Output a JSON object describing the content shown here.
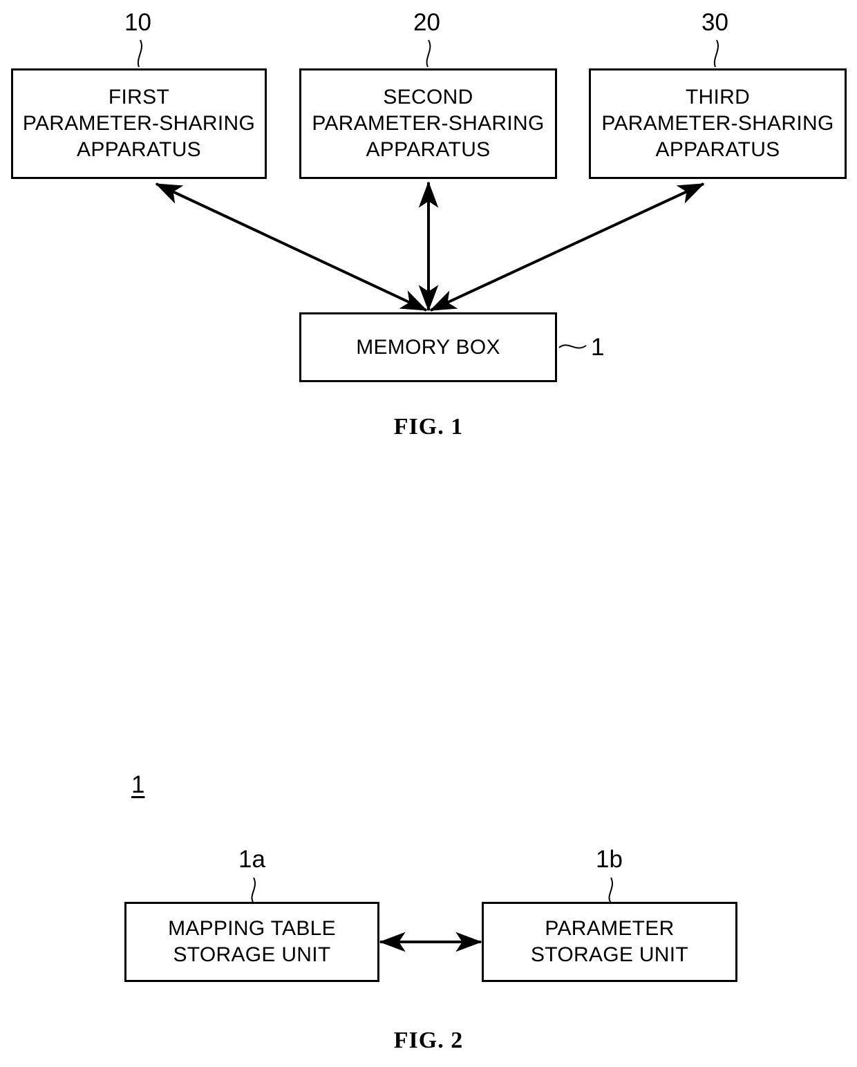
{
  "document": {
    "type": "patent-drawing-sheet",
    "figures": [
      {
        "id": "fig1",
        "caption": "FIG. 1",
        "nodes": [
          {
            "id": "first-apparatus",
            "label": "FIRST\nPARAMETER-SHARING\nAPPARATUS",
            "ref": "10"
          },
          {
            "id": "second-apparatus",
            "label": "SECOND\nPARAMETER-SHARING\nAPPARATUS",
            "ref": "20"
          },
          {
            "id": "third-apparatus",
            "label": "THIRD\nPARAMETER-SHARING\nAPPARATUS",
            "ref": "30"
          },
          {
            "id": "memory-box",
            "label": "MEMORY BOX",
            "ref": "1"
          }
        ],
        "connections": [
          {
            "from": "memory-box",
            "to": "first-apparatus",
            "style": "double-arrow"
          },
          {
            "from": "memory-box",
            "to": "second-apparatus",
            "style": "double-arrow"
          },
          {
            "from": "memory-box",
            "to": "third-apparatus",
            "style": "double-arrow"
          }
        ]
      },
      {
        "id": "fig2",
        "caption": "FIG. 2",
        "assembly_ref": "1",
        "nodes": [
          {
            "id": "mapping-table-storage-unit",
            "label": "MAPPING TABLE\nSTORAGE UNIT",
            "ref": "1a"
          },
          {
            "id": "parameter-storage-unit",
            "label": "PARAMETER\nSTORAGE UNIT",
            "ref": "1b"
          }
        ],
        "connections": [
          {
            "from": "mapping-table-storage-unit",
            "to": "parameter-storage-unit",
            "style": "double-arrow"
          }
        ]
      }
    ]
  },
  "fig1": {
    "caption": "FIG. 1",
    "box1": {
      "label": "FIRST\nPARAMETER-SHARING\nAPPARATUS",
      "ref": "10"
    },
    "box2": {
      "label": "SECOND\nPARAMETER-SHARING\nAPPARATUS",
      "ref": "20"
    },
    "box3": {
      "label": "THIRD\nPARAMETER-SHARING\nAPPARATUS",
      "ref": "30"
    },
    "memory": {
      "label": "MEMORY BOX",
      "ref": "1"
    }
  },
  "fig2": {
    "caption": "FIG. 2",
    "assembly_ref": "1",
    "left": {
      "label": "MAPPING TABLE\nSTORAGE UNIT",
      "ref": "1a"
    },
    "right": {
      "label": "PARAMETER\nSTORAGE UNIT",
      "ref": "1b"
    }
  },
  "colors": {
    "ink": "#000000",
    "paper": "#ffffff"
  }
}
